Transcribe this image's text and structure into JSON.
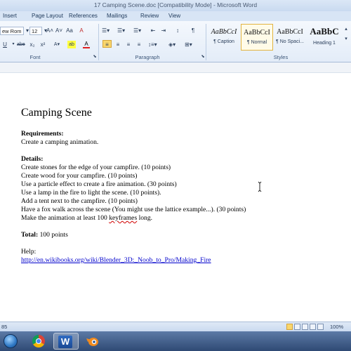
{
  "window": {
    "title": "17 Camping Scene.doc [Compatibility Mode] - Microsoft Word"
  },
  "ribbon_tabs": [
    "Insert",
    "Page Layout",
    "References",
    "Mailings",
    "Review",
    "View"
  ],
  "font": {
    "name": "ew Rom",
    "size": "12"
  },
  "font_buttons": {
    "grow": "A˄",
    "shrink": "A˅",
    "case": "Aa",
    "clear": "A",
    "underline": "U",
    "strike": "abe",
    "subscript": "x₂",
    "superscript": "x²",
    "highlight": "ab",
    "color": "A"
  },
  "paragraph_buttons": {
    "show_marks": "¶"
  },
  "group_labels": {
    "font": "Font",
    "paragraph": "Paragraph",
    "styles": "Styles"
  },
  "styles": [
    {
      "sample": "AaBbCcI",
      "name": "¶ Caption",
      "selected": false,
      "variant": "italic"
    },
    {
      "sample": "AaBbCcI",
      "name": "¶ Normal",
      "selected": true,
      "variant": "normal"
    },
    {
      "sample": "AaBbCcI",
      "name": "¶ No Spaci...",
      "selected": false,
      "variant": "normal"
    },
    {
      "sample": "AaBbC",
      "name": "Heading 1",
      "selected": false,
      "variant": "big"
    }
  ],
  "document": {
    "heading": "Camping Scene",
    "requirements_label": "Requirements:",
    "requirements_text": "Create a camping animation.",
    "details_label": "Details:",
    "details": [
      "Create stones for the edge of your campfire.  (10 points)",
      "Create wood for your campfire.  (10 points)",
      "Use a particle effect to create a fire animation.  (30 points)",
      "Use a lamp in the fire to light the scene.  (10 points).",
      "Add a tent next to the campfire.  (10 points)",
      "Have a fox walk across the scene (You might use the lattice example...).  (30 points)"
    ],
    "last_detail_pre": "Make the animation at least 100 ",
    "last_detail_squiggle": "keyframes",
    "last_detail_post": " long.",
    "total_label": "Total:",
    "total_value": " 100 points",
    "help_label": "Help:",
    "help_link": "http://en.wikibooks.org/wiki/Blender_3D:_Noob_to_Pro/Making_Fire"
  },
  "status": {
    "page_fragment": "85",
    "zoom": "100%"
  },
  "colors": {
    "ribbon_bg": "#e3ecf8",
    "taskbar": "#3b5684",
    "selected_style": "#e2b440",
    "link": "#0000cc"
  },
  "taskbar_apps": [
    "chrome-icon",
    "word-icon",
    "blender-icon"
  ]
}
